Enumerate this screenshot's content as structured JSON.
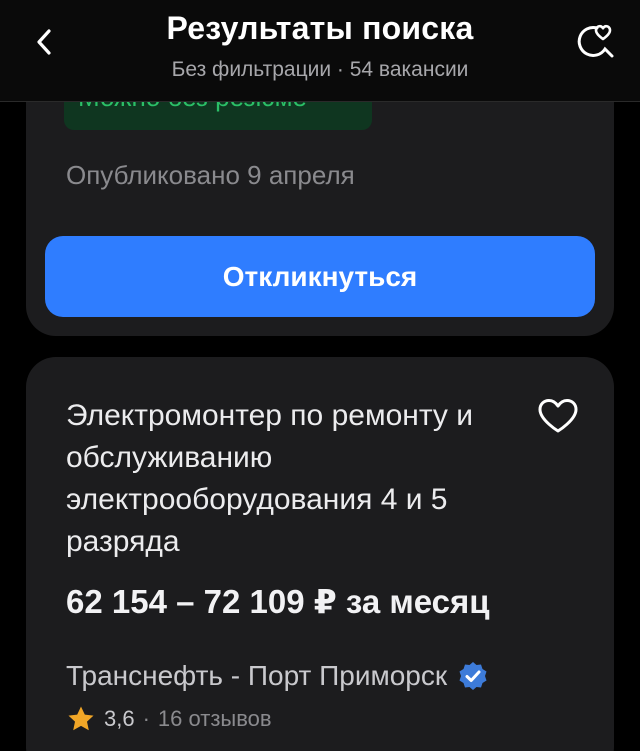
{
  "header": {
    "title": "Результаты поиска",
    "subtitle": "Без фильтрации · 54 вакансии",
    "back_icon": "chevron-left-icon",
    "right_icon": "search-heart-icon"
  },
  "previous_card": {
    "badge": "Можно без резюме",
    "published": "Опубликовано 9 апреля",
    "respond_button": "Откликнуться"
  },
  "vacancy": {
    "title": "Электромонтер по ремонту и обслуживанию электрооборудования 4 и 5 разряда",
    "salary": "62 154 – 72 109 ₽ за месяц",
    "company": "Транснефть - Порт Приморск",
    "rating": "3,6",
    "separator": "·",
    "reviews": "16 отзывов",
    "favorite_icon": "heart-outline-icon",
    "verified_icon": "verified-badge-icon",
    "star_icon": "star-icon"
  },
  "colors": {
    "accent": "#2f7dff",
    "card": "#1c1c1e",
    "badge_green": "#2bbf67",
    "verified": "#3d7bd9",
    "star": "#f1a627"
  }
}
